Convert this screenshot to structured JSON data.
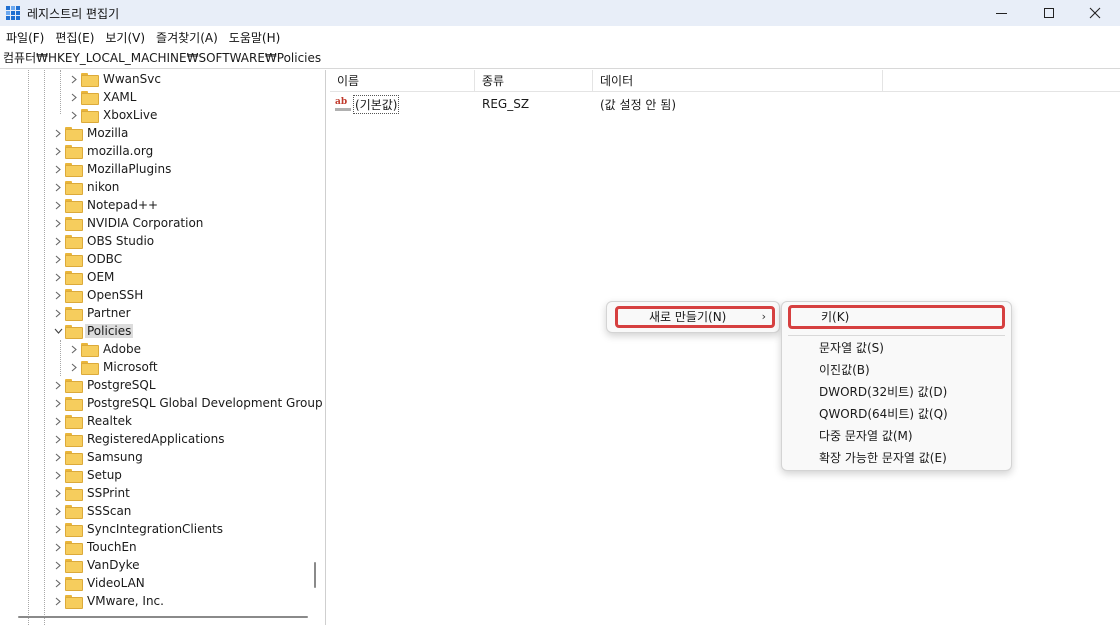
{
  "window": {
    "title": "레지스트리 편집기",
    "accent": "#1f6fd1"
  },
  "menubar": {
    "items": [
      "파일(F)",
      "편집(E)",
      "보기(V)",
      "즐겨찾기(A)",
      "도움말(H)"
    ]
  },
  "address": {
    "path": "컴퓨터₩HKEY_LOCAL_MACHINE₩SOFTWARE₩Policies"
  },
  "tree": {
    "items": [
      {
        "label": "WwanSvc",
        "level": 2,
        "expander": "collapsed"
      },
      {
        "label": "XAML",
        "level": 2,
        "expander": "none"
      },
      {
        "label": "XboxLive",
        "level": 2,
        "expander": "none"
      },
      {
        "label": "Mozilla",
        "level": 1,
        "expander": "collapsed"
      },
      {
        "label": "mozilla.org",
        "level": 1,
        "expander": "collapsed"
      },
      {
        "label": "MozillaPlugins",
        "level": 1,
        "expander": "collapsed"
      },
      {
        "label": "nikon",
        "level": 1,
        "expander": "collapsed"
      },
      {
        "label": "Notepad++",
        "level": 1,
        "expander": "none"
      },
      {
        "label": "NVIDIA Corporation",
        "level": 1,
        "expander": "collapsed"
      },
      {
        "label": "OBS Studio",
        "level": 1,
        "expander": "none"
      },
      {
        "label": "ODBC",
        "level": 1,
        "expander": "collapsed"
      },
      {
        "label": "OEM",
        "level": 1,
        "expander": "collapsed"
      },
      {
        "label": "OpenSSH",
        "level": 1,
        "expander": "collapsed"
      },
      {
        "label": "Partner",
        "level": 1,
        "expander": "collapsed"
      },
      {
        "label": "Policies",
        "level": 1,
        "expander": "expanded",
        "selected": true
      },
      {
        "label": "Adobe",
        "level": 2,
        "expander": "collapsed"
      },
      {
        "label": "Microsoft",
        "level": 2,
        "expander": "collapsed"
      },
      {
        "label": "PostgreSQL",
        "level": 1,
        "expander": "collapsed"
      },
      {
        "label": "PostgreSQL Global Development Group",
        "level": 1,
        "expander": "collapsed"
      },
      {
        "label": "Realtek",
        "level": 1,
        "expander": "collapsed"
      },
      {
        "label": "RegisteredApplications",
        "level": 1,
        "expander": "none"
      },
      {
        "label": "Samsung",
        "level": 1,
        "expander": "collapsed"
      },
      {
        "label": "Setup",
        "level": 1,
        "expander": "collapsed"
      },
      {
        "label": "SSPrint",
        "level": 1,
        "expander": "collapsed"
      },
      {
        "label": "SSScan",
        "level": 1,
        "expander": "collapsed"
      },
      {
        "label": "SyncIntegrationClients",
        "level": 1,
        "expander": "collapsed"
      },
      {
        "label": "TouchEn",
        "level": 1,
        "expander": "collapsed"
      },
      {
        "label": "VanDyke",
        "level": 1,
        "expander": "collapsed"
      },
      {
        "label": "VideoLAN",
        "level": 1,
        "expander": "collapsed"
      },
      {
        "label": "VMware, Inc.",
        "level": 1,
        "expander": "collapsed"
      }
    ]
  },
  "list": {
    "columns": {
      "name": "이름",
      "type": "종류",
      "data": "데이터"
    },
    "rows": [
      {
        "name": "(기본값)",
        "type": "REG_SZ",
        "data": "(값 설정 안 됨)",
        "icon": "ab-string-icon"
      }
    ]
  },
  "context_menu": {
    "new_label": "새로 만들기(N)",
    "submenu_arrow": "›",
    "highlight_color": "#d64040",
    "submenu": {
      "key": "키(K)",
      "items": [
        "문자열 값(S)",
        "이진값(B)",
        "DWORD(32비트) 값(D)",
        "QWORD(64비트) 값(Q)",
        "다중 문자열 값(M)",
        "확장 가능한 문자열 값(E)"
      ]
    }
  }
}
